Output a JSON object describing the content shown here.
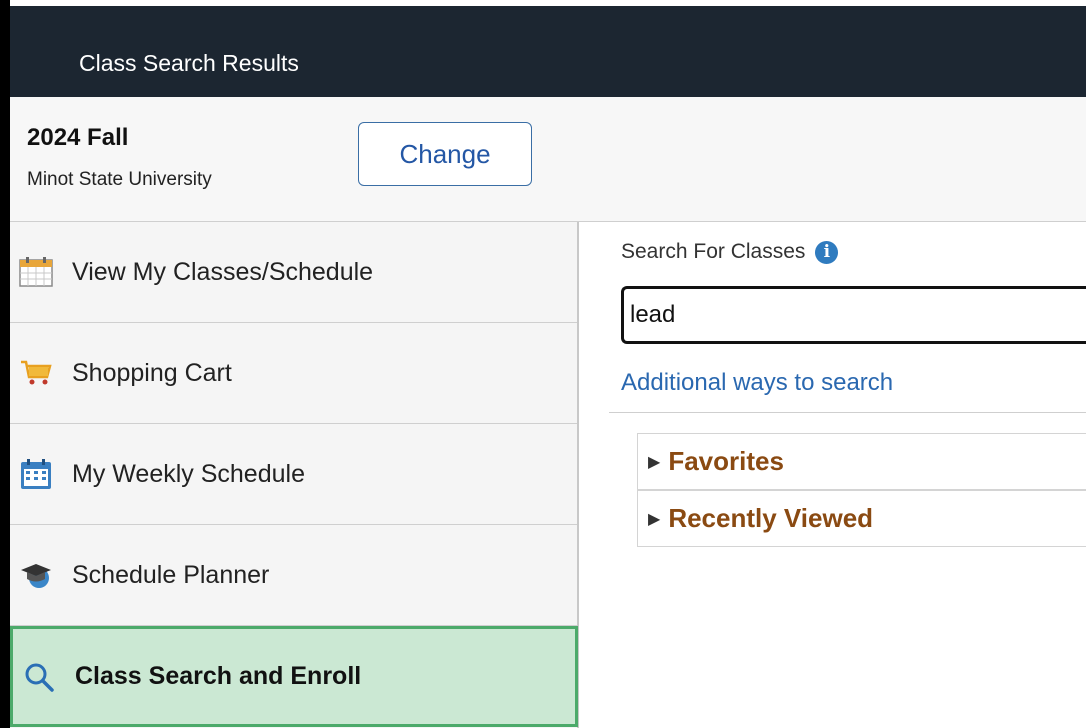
{
  "header": {
    "title": "Class Search Results"
  },
  "term": {
    "name": "2024 Fall",
    "institution": "Minot State University",
    "change_label": "Change"
  },
  "sidebar": {
    "items": [
      {
        "label": "View My Classes/Schedule",
        "icon": "calendar-icon"
      },
      {
        "label": "Shopping Cart",
        "icon": "shopping-cart-icon"
      },
      {
        "label": "My Weekly Schedule",
        "icon": "weekly-calendar-icon"
      },
      {
        "label": "Schedule Planner",
        "icon": "graduation-cap-icon"
      },
      {
        "label": "Class Search and Enroll",
        "icon": "search-icon",
        "active": true
      }
    ]
  },
  "search": {
    "label": "Search For Classes",
    "value": "lead",
    "additional_link": "Additional ways to search"
  },
  "accordions": [
    {
      "label": "Favorites"
    },
    {
      "label": "Recently Viewed"
    }
  ],
  "colors": {
    "header_bg": "#1c2631",
    "accent_link": "#2a68b0",
    "active_nav_bg": "#cbe8d3",
    "accordion_text": "#8a4a12"
  }
}
